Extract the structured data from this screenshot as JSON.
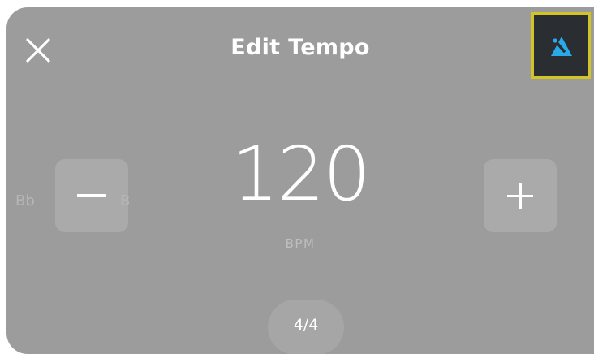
{
  "header": {
    "title": "Edit Tempo",
    "close_icon": "close-icon",
    "metronome_icon": "metronome-icon"
  },
  "tempo": {
    "value": "120",
    "unit": "BPM",
    "decrease_icon": "minus-icon",
    "increase_icon": "plus-icon",
    "note_left": "Bb",
    "note_right": "B"
  },
  "time_signature": {
    "value": "4/4"
  },
  "colors": {
    "background": "#9c9c9c",
    "highlight_border": "#d2c425",
    "metronome_bg": "#2a2d31",
    "metronome_accent": "#29a9e8"
  }
}
